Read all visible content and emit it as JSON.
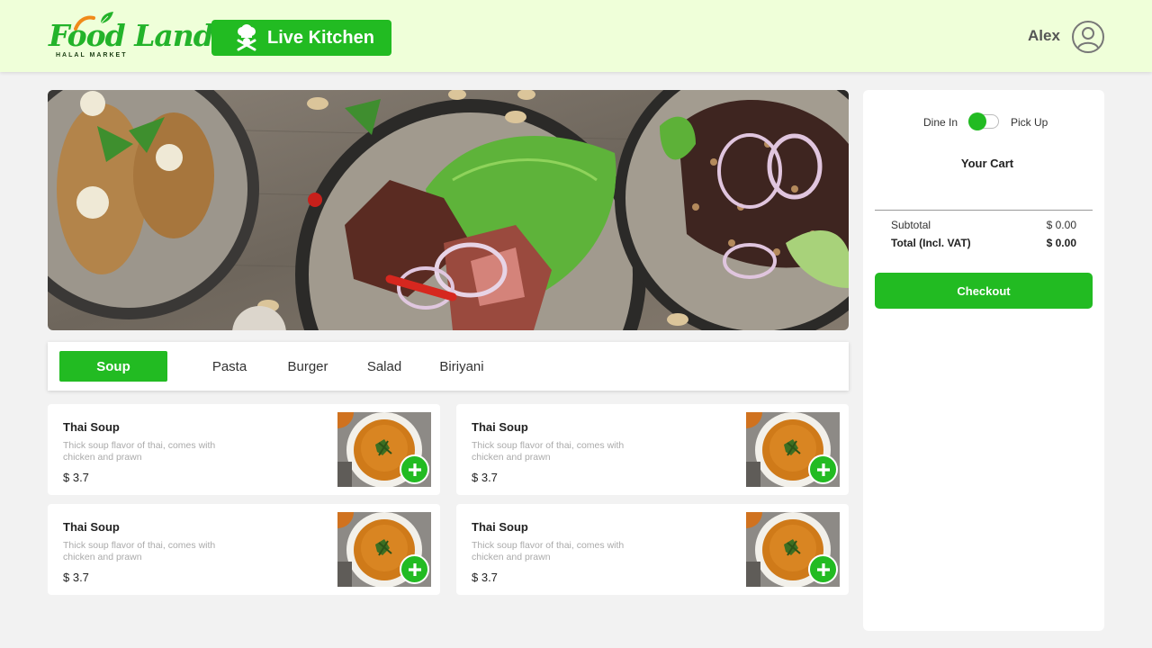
{
  "header": {
    "logo_text": "Food Land",
    "logo_subtitle": "HALAL MARKET",
    "live_kitchen_label": "Live Kitchen",
    "user_name": "Alex"
  },
  "categories": [
    "Soup",
    "Pasta",
    "Burger",
    "Salad",
    "Biriyani"
  ],
  "active_category": "Soup",
  "products": [
    {
      "name": "Thai Soup",
      "description": "Thick soup flavor of thai, comes with chicken and prawn",
      "price": "$ 3.7"
    },
    {
      "name": "Thai Soup",
      "description": "Thick soup flavor of thai, comes with chicken and prawn",
      "price": "$ 3.7"
    },
    {
      "name": "Thai Soup",
      "description": "Thick soup flavor of thai, comes with chicken and prawn",
      "price": "$ 3.7"
    },
    {
      "name": "Thai Soup",
      "description": "Thick soup flavor of thai, comes with chicken and prawn",
      "price": "$ 3.7"
    }
  ],
  "cart": {
    "dine_in_label": "Dine In",
    "pick_up_label": "Pick Up",
    "title": "Your Cart",
    "subtotal_label": "Subtotal",
    "subtotal_value": "$ 0.00",
    "total_label": "Total (Incl. VAT)",
    "total_value": "$ 0.00",
    "checkout_label": "Checkout"
  },
  "icons": {
    "live_kitchen": "chef-hat-icon",
    "user": "user-avatar-icon",
    "add": "plus-icon"
  },
  "colors": {
    "brand_green": "#22bb22",
    "header_bg": "#efffd9",
    "page_bg": "#f2f2f2"
  }
}
